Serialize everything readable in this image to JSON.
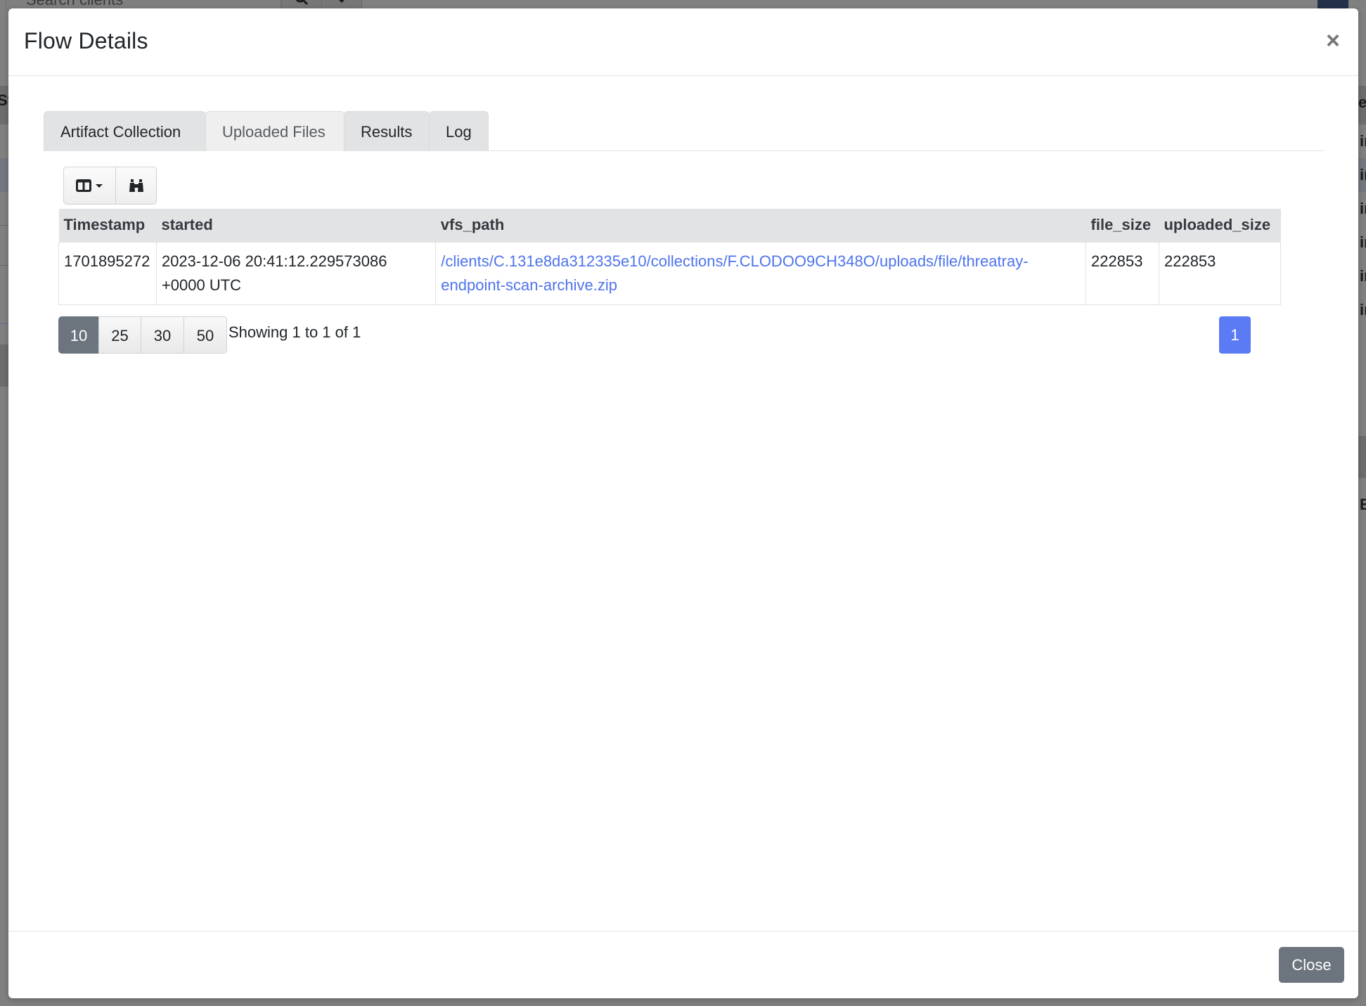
{
  "background": {
    "search_placeholder": "Search clients",
    "search_icon": "search-icon",
    "dropdown_icon": "caret-down-icon",
    "logout_icon": "logout-icon",
    "left_fragment": "St",
    "right_fragments": [
      "ea",
      "in",
      "in",
      "in",
      "in",
      "in",
      "in",
      "B"
    ]
  },
  "modal": {
    "title": "Flow Details",
    "close_symbol": "×",
    "tabs": [
      {
        "label": "Artifact Collection",
        "active": false
      },
      {
        "label": "Uploaded Files",
        "active": true
      },
      {
        "label": "Results",
        "active": false
      },
      {
        "label": "Log",
        "active": false
      }
    ],
    "toolbar": {
      "columns_icon": "columns-icon",
      "columns_caret": "caret-down-icon",
      "search_icon": "binoculars-icon"
    },
    "table": {
      "columns": [
        "Timestamp",
        "started",
        "vfs_path",
        "file_size",
        "uploaded_size"
      ],
      "rows": [
        {
          "Timestamp": "1701895272",
          "started": "2023-12-06 20:41:12.229573086 +0000 UTC",
          "vfs_path": "/clients/C.131e8da312335e10/collections/F.CLODOO9CH348O/uploads/file/threatray-endpoint-scan-archive.zip",
          "file_size": "222853",
          "uploaded_size": "222853"
        }
      ]
    },
    "pagination": {
      "page_sizes": [
        "10",
        "25",
        "30",
        "50"
      ],
      "selected_page_size": "10",
      "showing_text": "Showing 1 to 1 of 1",
      "pages": [
        "1"
      ],
      "current_page": "1"
    },
    "footer": {
      "close_label": "Close"
    }
  },
  "colors": {
    "link": "#4e73ee",
    "active_page": "#5b7bf5",
    "secondary_button": "#6c757d",
    "table_header_bg": "#e2e3e5",
    "overlay": "#808080"
  }
}
